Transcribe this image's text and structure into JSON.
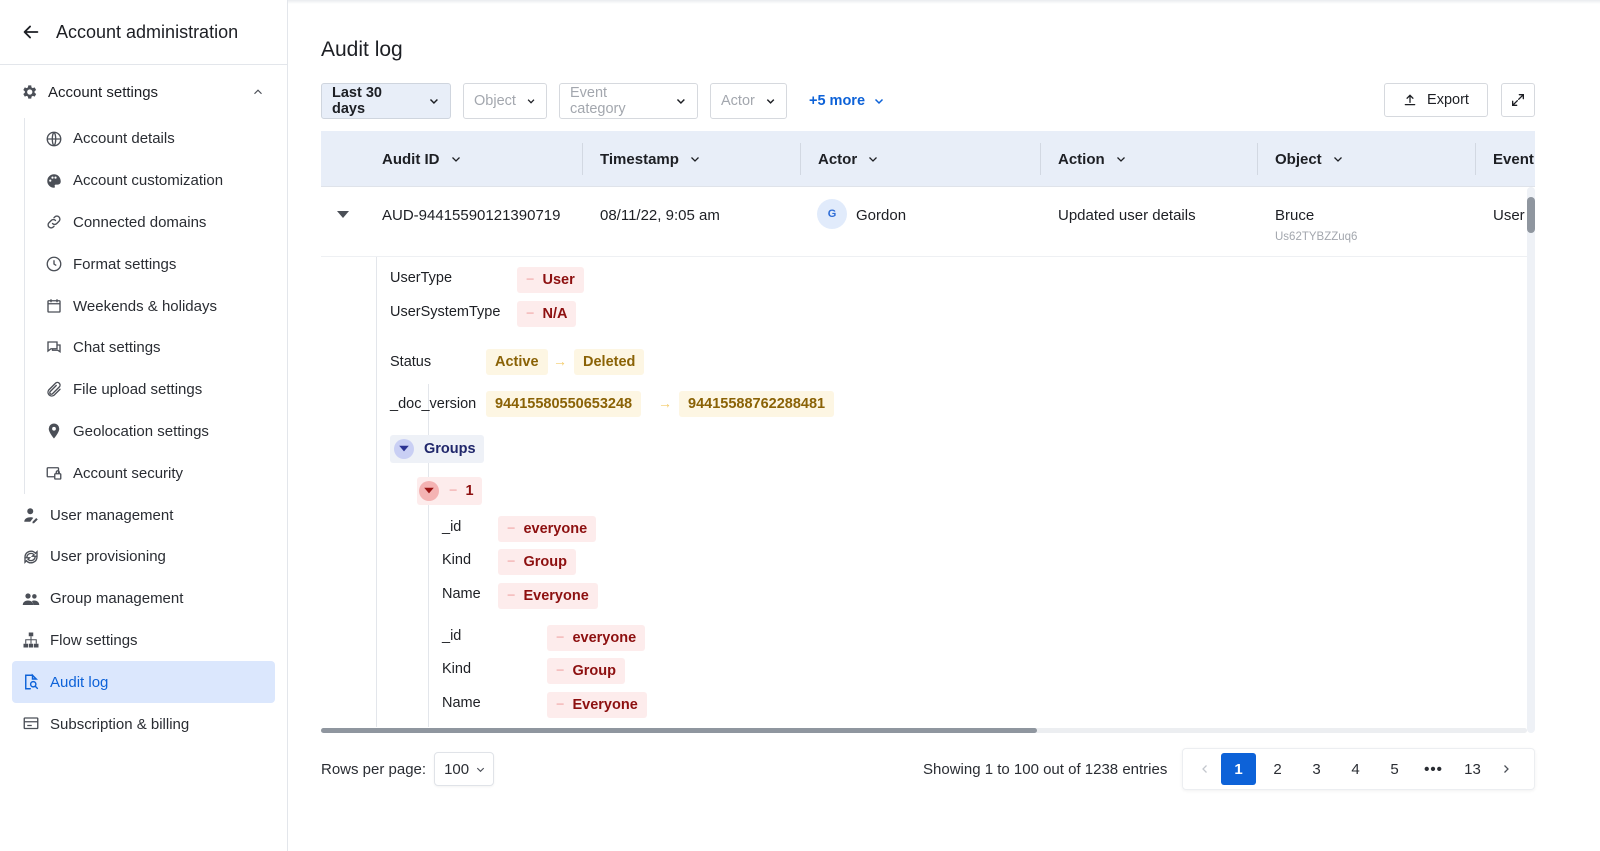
{
  "sidebar": {
    "title": "Account administration",
    "account_settings": {
      "label": "Account settings",
      "items": [
        {
          "label": "Account details",
          "icon": "globe-icon"
        },
        {
          "label": "Account customization",
          "icon": "palette-icon"
        },
        {
          "label": "Connected domains",
          "icon": "link-icon"
        },
        {
          "label": "Format settings",
          "icon": "clock-icon"
        },
        {
          "label": "Weekends & holidays",
          "icon": "calendar-icon"
        },
        {
          "label": "Chat settings",
          "icon": "chat-icon"
        },
        {
          "label": "File upload settings",
          "icon": "paperclip-icon"
        },
        {
          "label": "Geolocation settings",
          "icon": "location-pin-icon"
        },
        {
          "label": "Account security",
          "icon": "security-icon"
        }
      ]
    },
    "items": [
      {
        "label": "User management",
        "icon": "user-icon"
      },
      {
        "label": "User provisioning",
        "icon": "sync-icon"
      },
      {
        "label": "Group management",
        "icon": "group-icon"
      },
      {
        "label": "Flow settings",
        "icon": "flow-icon"
      },
      {
        "label": "Audit log",
        "icon": "audit-icon",
        "active": true
      },
      {
        "label": "Subscription & billing",
        "icon": "billing-icon"
      }
    ]
  },
  "page": {
    "title": "Audit log",
    "filters": {
      "range": "Last 30 days",
      "object": "Object",
      "event_category": "Event category",
      "actor": "Actor",
      "more": "+5 more"
    },
    "export_label": "Export"
  },
  "table": {
    "columns": [
      "Audit ID",
      "Timestamp",
      "Actor",
      "Action",
      "Object",
      "Event"
    ],
    "row": {
      "audit_id": "AUD-94415590121390719",
      "timestamp": "08/11/22, 9:05 am",
      "actor_initial": "G",
      "actor": "Gordon",
      "action": "Updated user details",
      "object": "Bruce",
      "object_id": "Us62TYBZZuq6",
      "event": "User"
    },
    "detail": {
      "user_type_label": "UserType",
      "user_type_value": "User",
      "user_system_type_label": "UserSystemType",
      "user_system_type_value": "N/A",
      "status_label": "Status",
      "status_from": "Active",
      "status_to": "Deleted",
      "doc_version_label": "_doc_version",
      "doc_version_from": "94415580550653248",
      "doc_version_to": "94415588762288481",
      "groups_label": "Groups",
      "group_index": "1",
      "group_fields": [
        {
          "label": "_id",
          "value": "everyone"
        },
        {
          "label": "Kind",
          "value": "Group"
        },
        {
          "label": "Name",
          "value": "Everyone"
        }
      ],
      "group_fields_2": [
        {
          "label": "_id",
          "value": "everyone"
        },
        {
          "label": "Kind",
          "value": "Group"
        },
        {
          "label": "Name",
          "value": "Everyone"
        }
      ],
      "removed_marker": "−",
      "arrow": "→"
    }
  },
  "pagination": {
    "rows_per_page_label": "Rows per page:",
    "rows_per_page": "100",
    "showing": "Showing 1 to 100 out of 1238 entries",
    "pages": [
      "1",
      "2",
      "3",
      "4",
      "5",
      "•••",
      "13"
    ],
    "current_page": "1"
  },
  "colors": {
    "accent": "#0d62d8",
    "active_bg": "#dbe7fd",
    "header_bg": "#e8eef8",
    "removed_bg": "#fdecec",
    "removed_text": "#8d1010",
    "changed_bg": "#fdf6e3",
    "changed_text": "#8a6206"
  }
}
